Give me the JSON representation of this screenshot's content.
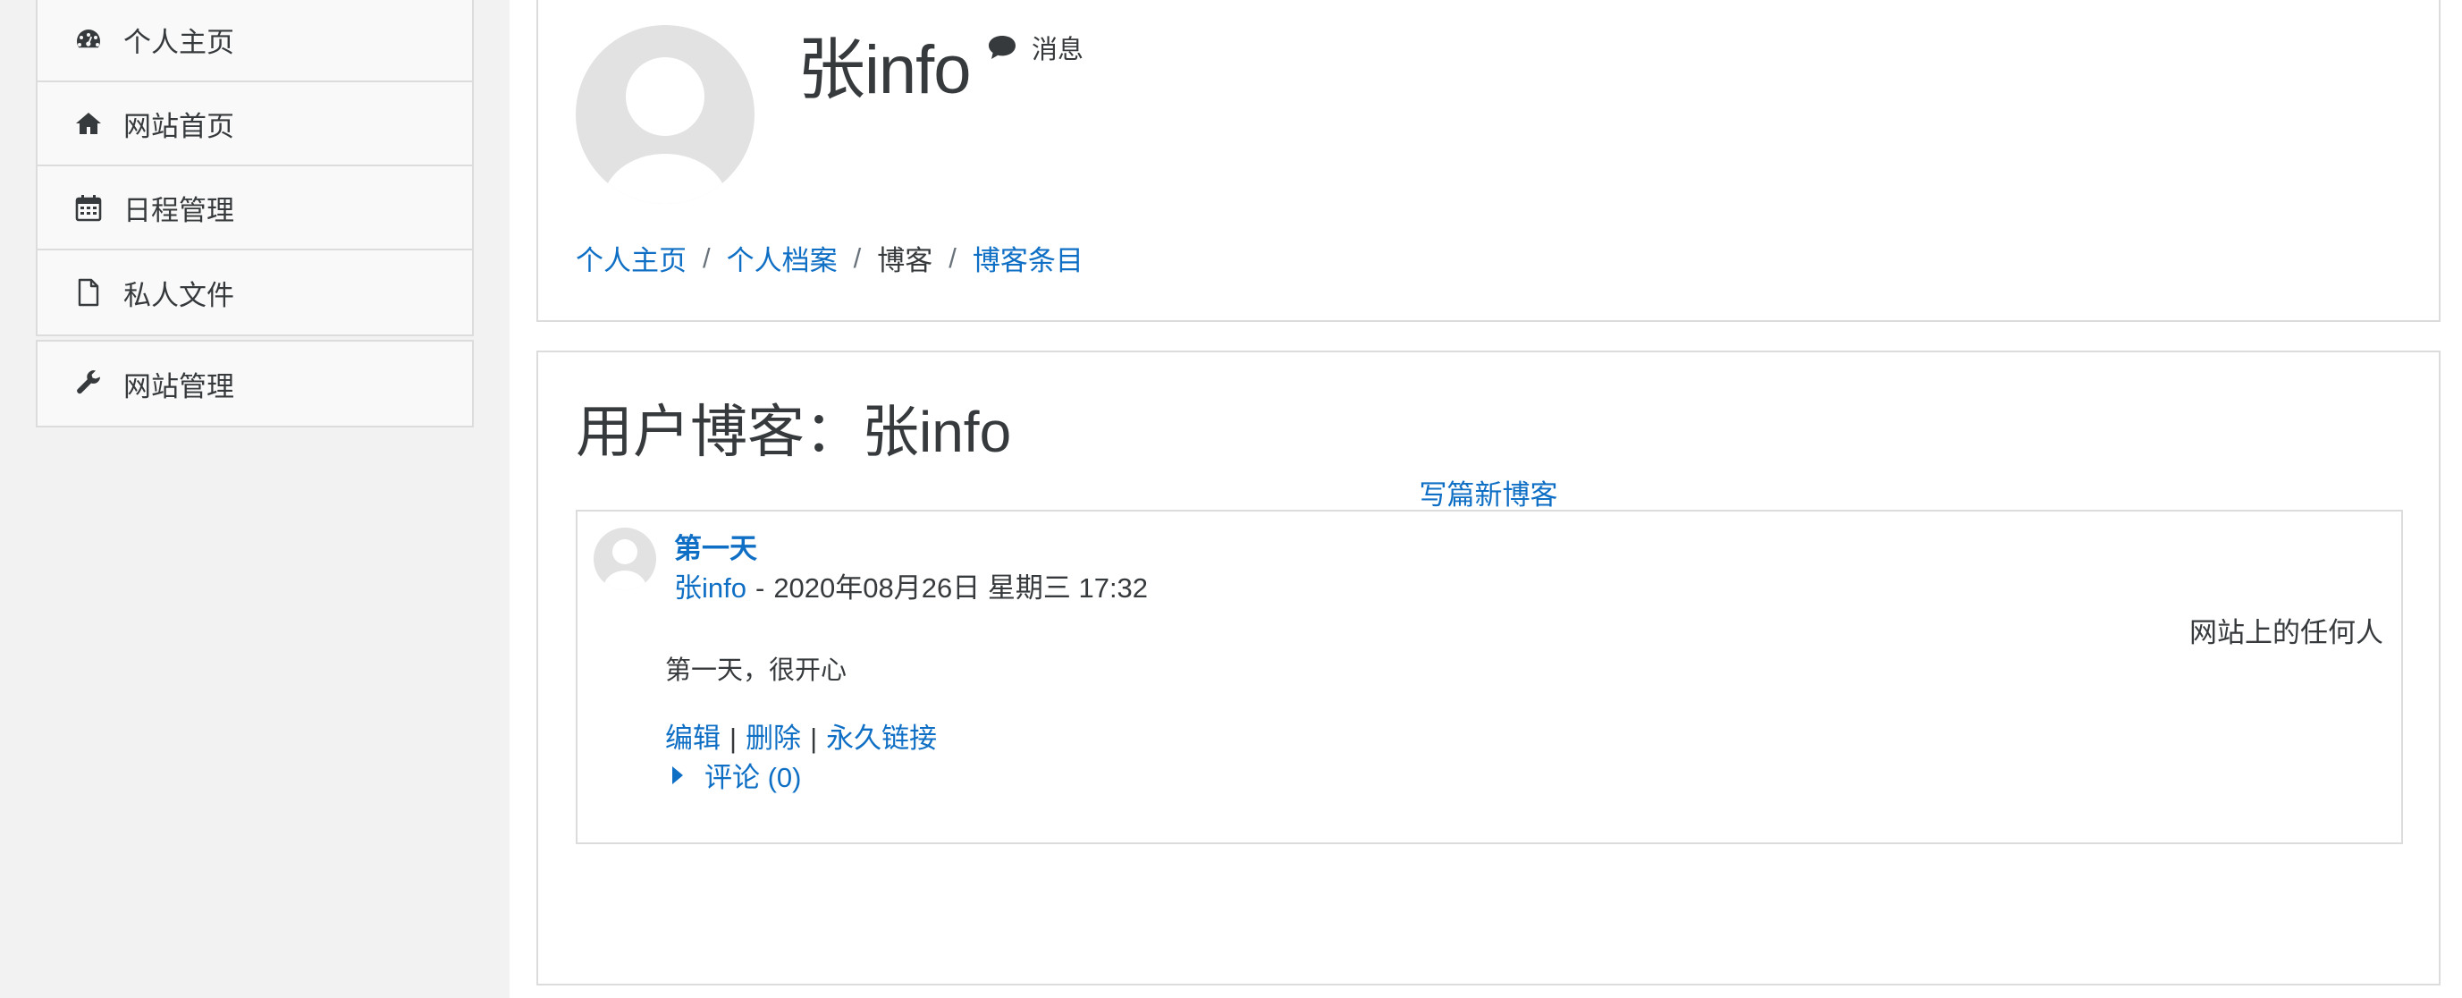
{
  "sidebar": {
    "primary_items": [
      {
        "label": "个人主页",
        "icon": "dashboard-icon"
      },
      {
        "label": "网站首页",
        "icon": "home-icon"
      },
      {
        "label": "日程管理",
        "icon": "calendar-icon"
      },
      {
        "label": "私人文件",
        "icon": "file-icon"
      }
    ],
    "secondary_items": [
      {
        "label": "网站管理",
        "icon": "wrench-icon"
      }
    ]
  },
  "header": {
    "user_name": "张info",
    "message_label": "消息",
    "breadcrumb": [
      "个人主页",
      "个人档案",
      "博客",
      "博客条目"
    ],
    "breadcrumb_separator": "/"
  },
  "main": {
    "blog_title": "用户博客：张info",
    "new_entry_label": "写篇新博客",
    "entry": {
      "title": "第一天",
      "author": "张info",
      "dash": "-",
      "datetime": "2020年08月26日 星期三 17:32",
      "visibility": "网站上的任何人",
      "body": "第一天，很开心",
      "actions": [
        "编辑",
        "删除",
        "永久链接"
      ],
      "action_separator": "|",
      "comments_label": "评论 (0)"
    }
  },
  "colors": {
    "link": "#0f6fc5",
    "text": "#373a3c",
    "sidebar_bg": "#f2f2f2",
    "border": "#dcdcdc"
  }
}
